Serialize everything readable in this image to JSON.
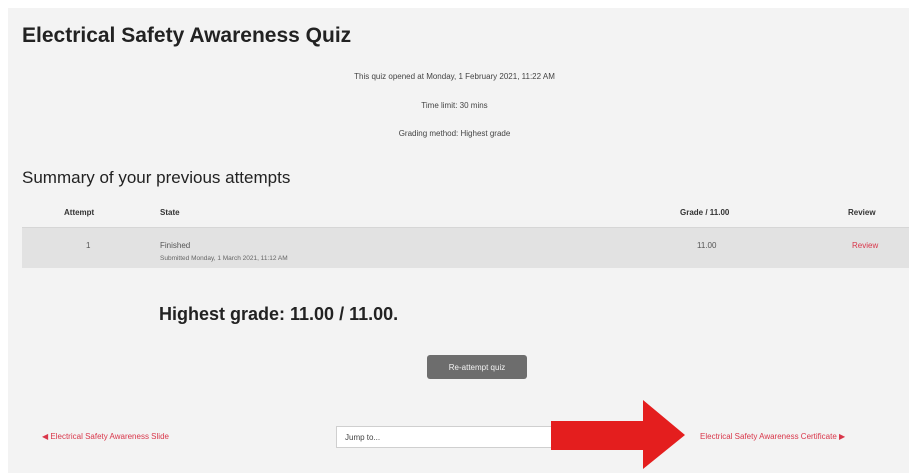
{
  "quiz": {
    "title": "Electrical Safety Awareness Quiz",
    "opened": "This quiz opened at Monday, 1 February 2021, 11:22 AM",
    "time_limit": "Time limit: 30 mins",
    "grading_method": "Grading method: Highest grade"
  },
  "summary": {
    "heading": "Summary of your previous attempts",
    "columns": [
      "Attempt",
      "State",
      "Grade / 11.00",
      "Review"
    ],
    "rows": [
      {
        "attempt": "1",
        "state": "Finished",
        "submitted": "Submitted Monday, 1 March 2021, 11:12 AM",
        "grade": "11.00",
        "review": "Review"
      }
    ]
  },
  "result": {
    "highest_grade": "Highest grade: 11.00 / 11.00."
  },
  "actions": {
    "reattempt_label": "Re-attempt quiz"
  },
  "navigation": {
    "prev_label": "Electrical Safety Awareness Slide",
    "jump_placeholder": "Jump to...",
    "next_label": "Electrical Safety Awareness Certificate"
  },
  "colors": {
    "accent": "#d9364a",
    "annotation_arrow": "#e41e1e",
    "button": "#6d6d6d"
  },
  "icons": {
    "prev": "triangle-left-icon",
    "next": "triangle-right-icon",
    "annotation": "red-arrow-icon"
  }
}
